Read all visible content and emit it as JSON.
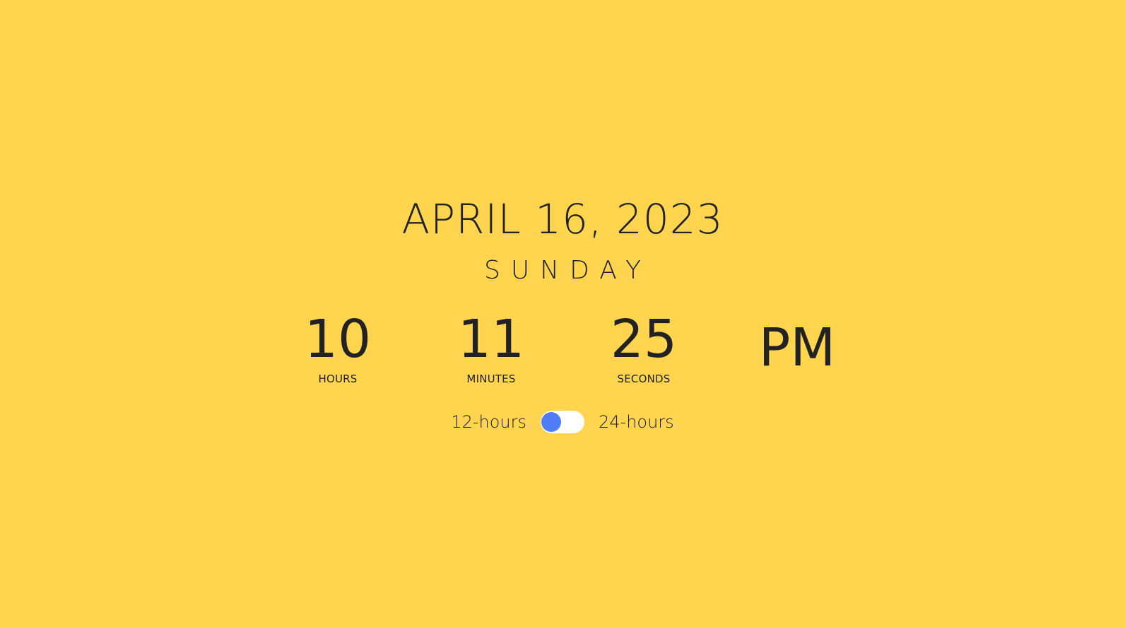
{
  "date": "APRIL 16, 2023",
  "day": "SUNDAY",
  "time": {
    "hours": {
      "value": "10",
      "label": "HOURS"
    },
    "minutes": {
      "value": "11",
      "label": "MINUTES"
    },
    "seconds": {
      "value": "25",
      "label": "SECONDS"
    },
    "ampm": "PM"
  },
  "format_toggle": {
    "left_label": "12-hours",
    "right_label": "24-hours",
    "selected": "12-hours"
  },
  "colors": {
    "background": "#FFD54F",
    "text": "#222222",
    "toggle_track": "#FFFFFF",
    "toggle_knob": "#4F7CF7"
  }
}
